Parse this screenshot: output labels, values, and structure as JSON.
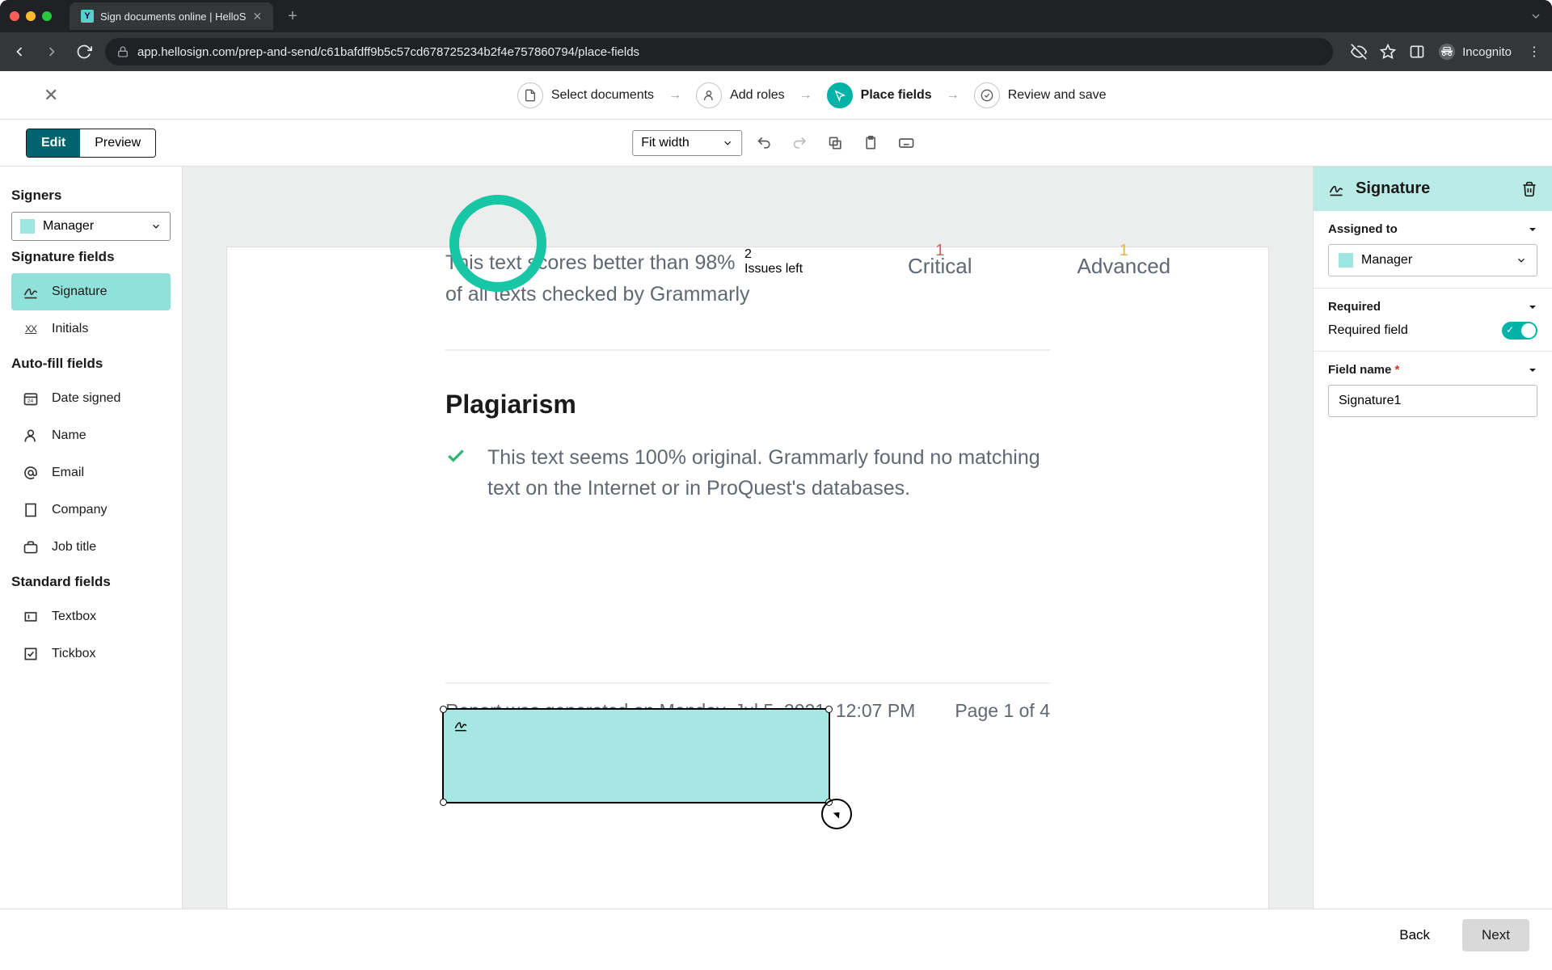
{
  "browser": {
    "tab_title": "Sign documents online | HelloS",
    "url": "app.hellosign.com/prep-and-send/c61bafdff9b5c57cd678725234b2f4e757860794/place-fields",
    "incognito_label": "Incognito"
  },
  "stepper": {
    "steps": [
      "Select documents",
      "Add roles",
      "Place fields",
      "Review and save"
    ],
    "active_index": 2
  },
  "toolbar": {
    "edit_label": "Edit",
    "preview_label": "Preview",
    "zoom_label": "Fit width"
  },
  "left_panel": {
    "signers_title": "Signers",
    "signer_selected": "Manager",
    "sig_fields_title": "Signature fields",
    "sig_fields": [
      {
        "icon": "pen",
        "label": "Signature",
        "active": true
      },
      {
        "icon": "xx",
        "label": "Initials",
        "active": false
      }
    ],
    "auto_title": "Auto-fill fields",
    "auto_fields": [
      {
        "icon": "cal",
        "label": "Date signed"
      },
      {
        "icon": "person",
        "label": "Name"
      },
      {
        "icon": "at",
        "label": "Email"
      },
      {
        "icon": "building",
        "label": "Company"
      },
      {
        "icon": "briefcase",
        "label": "Job title"
      }
    ],
    "std_title": "Standard fields",
    "std_fields": [
      {
        "icon": "textbox",
        "label": "Textbox"
      },
      {
        "icon": "tick",
        "label": "Tickbox"
      }
    ]
  },
  "document": {
    "issues_left_num": "2",
    "issues_left_label": "Issues left",
    "critical_num": "1",
    "critical_label": "Critical",
    "advanced_num": "1",
    "advanced_label": "Advanced",
    "score_line1": "This text scores better than 98%",
    "score_line2": "of all texts checked by Grammarly",
    "plagiarism_heading": "Plagiarism",
    "plagiarism_text": "This text seems 100% original. Grammarly found no matching text on the Internet or in ProQuest's databases.",
    "report_generated": "Report was generated on Monday, Jul 5, 2021, 12:07 PM",
    "page_label": "Page 1 of 4"
  },
  "right_panel": {
    "title": "Signature",
    "assigned_label": "Assigned to",
    "assigned_value": "Manager",
    "required_section": "Required",
    "required_field_label": "Required field",
    "field_name_label": "Field name",
    "field_name_value": "Signature1"
  },
  "footer": {
    "back": "Back",
    "next": "Next"
  }
}
